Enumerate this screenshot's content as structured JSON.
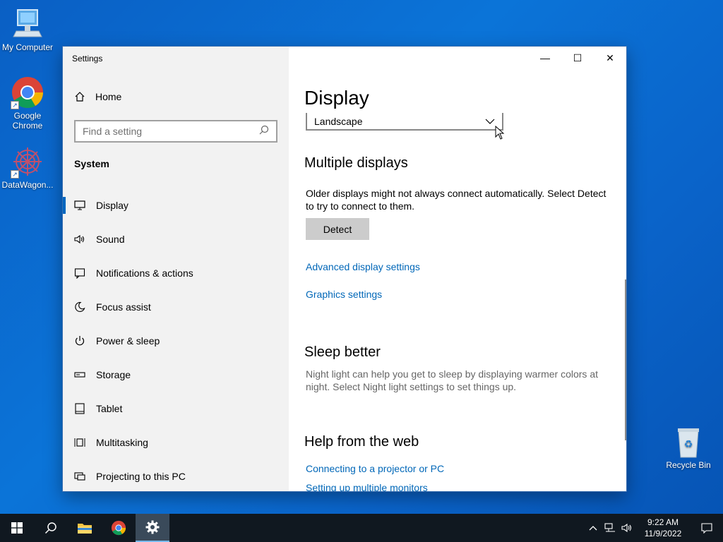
{
  "desktop": {
    "icons": [
      {
        "label": "My Computer"
      },
      {
        "label": "Google Chrome"
      },
      {
        "label": "DataWagon..."
      },
      {
        "label": "Recycle Bin"
      }
    ]
  },
  "window": {
    "title": "Settings",
    "controls": {
      "minimize": "—",
      "maximize": "☐",
      "close": "✕"
    }
  },
  "sidebar": {
    "home_label": "Home",
    "search_placeholder": "Find a setting",
    "section": "System",
    "items": [
      {
        "label": "Display",
        "icon": "monitor-icon",
        "active": true
      },
      {
        "label": "Sound",
        "icon": "speaker-icon"
      },
      {
        "label": "Notifications & actions",
        "icon": "notification-icon"
      },
      {
        "label": "Focus assist",
        "icon": "moon-icon"
      },
      {
        "label": "Power & sleep",
        "icon": "power-icon"
      },
      {
        "label": "Storage",
        "icon": "storage-icon"
      },
      {
        "label": "Tablet",
        "icon": "tablet-icon"
      },
      {
        "label": "Multitasking",
        "icon": "multitasking-icon"
      },
      {
        "label": "Projecting to this PC",
        "icon": "projector-icon"
      }
    ]
  },
  "content": {
    "title": "Display",
    "orientation_value": "Landscape",
    "multiple_displays": {
      "heading": "Multiple displays",
      "description": "Older displays might not always connect automatically. Select Detect to try to connect to them.",
      "detect_button": "Detect",
      "advanced_link": "Advanced display settings",
      "graphics_link": "Graphics settings"
    },
    "sleep_better": {
      "heading": "Sleep better",
      "description": "Night light can help you get to sleep by displaying warmer colors at night. Select Night light settings to set things up."
    },
    "help": {
      "heading": "Help from the web",
      "links": [
        "Connecting to a projector or PC",
        "Setting up multiple monitors"
      ]
    }
  },
  "taskbar": {
    "time": "9:22 AM",
    "date": "11/9/2022"
  },
  "colors": {
    "accent": "#0067c0",
    "link": "#0067b8",
    "taskbar": "#101820"
  }
}
